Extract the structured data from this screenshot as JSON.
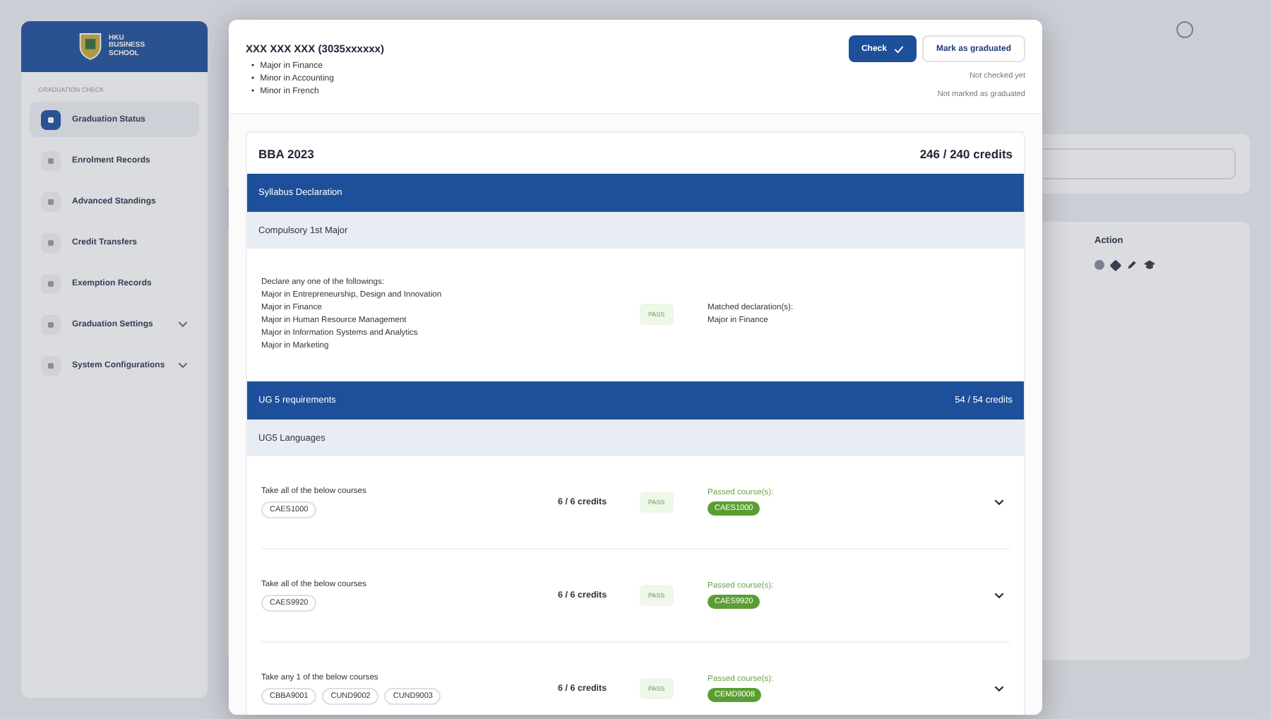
{
  "sidebar": {
    "logo": "HKU BUSINESS SCHOOL",
    "section": "GRADUATION CHECK",
    "items": [
      {
        "label": "Graduation Status",
        "selected": true,
        "expandable": false
      },
      {
        "label": "Enrolment Records",
        "selected": false,
        "expandable": false
      },
      {
        "label": "Advanced Standings",
        "selected": false,
        "expandable": false
      },
      {
        "label": "Credit Transfers",
        "selected": false,
        "expandable": false
      },
      {
        "label": "Exemption Records",
        "selected": false,
        "expandable": false
      },
      {
        "label": "Graduation Settings",
        "selected": false,
        "expandable": true
      },
      {
        "label": "System Configurations",
        "selected": false,
        "expandable": true
      }
    ]
  },
  "table": {
    "columns": [
      "Action"
    ]
  },
  "modal": {
    "student": {
      "name": "XXX XXX XXX (3035xxxxxx)",
      "bullet": "•",
      "programmes": [
        "Major in Finance",
        "Minor in Accounting",
        "Minor in French"
      ]
    },
    "buttons": [
      {
        "label": "Check",
        "kind": "primary"
      },
      {
        "label": "Mark as graduated",
        "kind": "secondary"
      }
    ],
    "statuses": [
      "Not checked yet",
      "Not marked as graduated"
    ],
    "curriculum": {
      "title": "BBA 2023",
      "credits": "246 / 240 credits",
      "sections": [
        {
          "title": "Syllabus Declaration",
          "groups": [
            {
              "title": "Compulsory 1st Major",
              "requirements": [
                {
                  "kind": "declaration",
                  "lines": [
                    "Declare any one of the followings:",
                    "Major in Entrepreneurship, Design and Innovation",
                    "Major in Finance",
                    "Major in Human Resource Management",
                    "Major in Information Systems and Analytics",
                    "Major in Marketing"
                  ],
                  "result": "PASS",
                  "matched_label": "Matched declaration(s):",
                  "matched": [
                    "Major in Finance"
                  ]
                }
              ]
            }
          ]
        },
        {
          "title": "UG 5 requirements",
          "credits": "54 / 54 credits",
          "groups": [
            {
              "title": "UG5 Languages",
              "requirements": [
                {
                  "kind": "courses",
                  "rule": "Take all of the below courses",
                  "courses": [
                    "CAES1000"
                  ],
                  "credits": "6 / 6 credits",
                  "result": "PASS",
                  "passed_label": "Passed course(s):",
                  "passed": [
                    "CAES1000"
                  ]
                },
                {
                  "kind": "courses",
                  "rule": "Take all of the below courses",
                  "courses": [
                    "CAES9920"
                  ],
                  "credits": "6 / 6 credits",
                  "result": "PASS",
                  "passed_label": "Passed course(s):",
                  "passed": [
                    "CAES9920"
                  ]
                },
                {
                  "kind": "courses",
                  "rule": "Take any 1 of the below courses",
                  "courses": [
                    "CBBA9001",
                    "CUND9002",
                    "CUND9003"
                  ],
                  "credits": "6 / 6 credits",
                  "result": "PASS",
                  "passed_label": "Passed course(s):",
                  "passed": [
                    "CEMD9008"
                  ]
                }
              ]
            }
          ]
        }
      ]
    }
  }
}
